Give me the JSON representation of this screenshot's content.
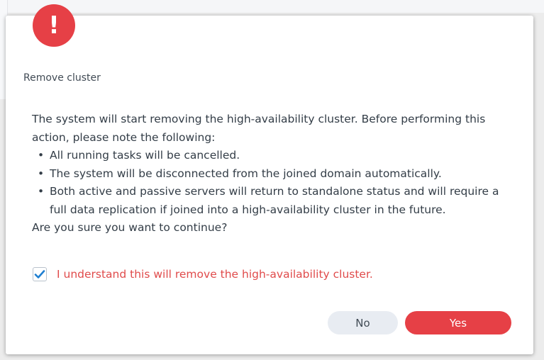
{
  "dialog": {
    "title": "Remove cluster",
    "alert_symbol": "!",
    "intro": "The system will start removing the high-availability cluster. Before performing this action, please note the following:",
    "bullets": [
      "All running tasks will be cancelled.",
      "The system will be disconnected from the joined domain automatically.",
      "Both active and passive servers will return to standalone status and will require a full data replication if joined into a high-availability cluster in the future."
    ],
    "question": "Are you sure you want to continue?",
    "confirm": {
      "label": "I understand this will remove the high-availability cluster.",
      "checked": true
    },
    "buttons": {
      "no_label": "No",
      "yes_label": "Yes"
    }
  },
  "icons": {
    "alert": "exclamation-icon",
    "check": "checkmark-icon"
  },
  "colors": {
    "danger": "#e64046",
    "confirm_text": "#e04b4b",
    "check_accent": "#1f7fd1",
    "secondary_button": "#e8ecf2"
  }
}
